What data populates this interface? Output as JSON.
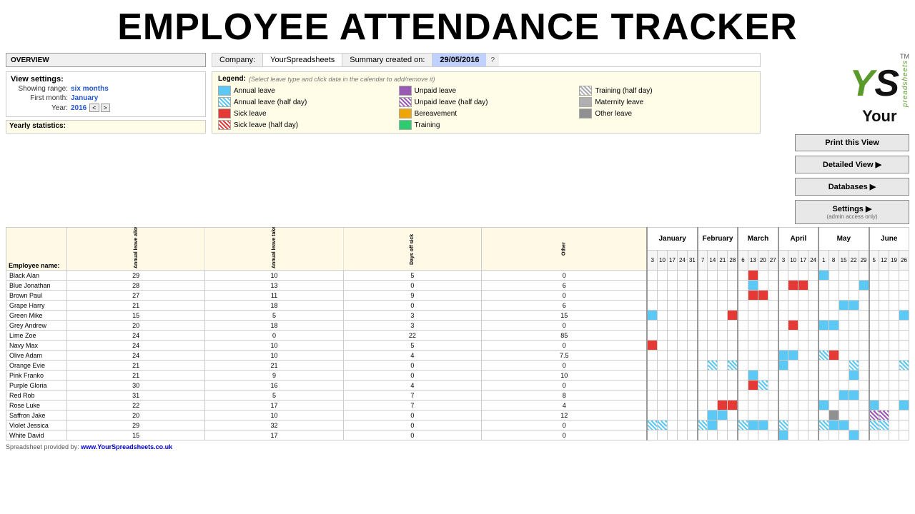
{
  "title": "EMPLOYEE ATTENDANCE TRACKER",
  "header": {
    "company_label": "Company:",
    "company_value": "YourSpreadsheets",
    "summary_label": "Summary created on:",
    "summary_date": "29/05/2016",
    "overview_label": "OVERVIEW"
  },
  "view_settings": {
    "label": "View settings:",
    "showing_range_label": "Showing range:",
    "showing_range_value": "six months",
    "first_month_label": "First month:",
    "first_month_value": "January",
    "year_label": "Year:",
    "year_value": "2016"
  },
  "legend": {
    "title": "Legend:",
    "hint": "(Select leave type and click data in the calendar to add/remove it)",
    "items": [
      {
        "label": "Annual leave",
        "color": "#5bc8f5",
        "type": "solid"
      },
      {
        "label": "Annual leave (half day)",
        "color": "#5bc8f5",
        "type": "stripe"
      },
      {
        "label": "Sick leave",
        "color": "#e53935",
        "type": "solid"
      },
      {
        "label": "Sick leave (half day)",
        "color": "#e53935",
        "type": "stripe"
      },
      {
        "label": "Unpaid leave",
        "color": "#9b59b6",
        "type": "solid"
      },
      {
        "label": "Unpaid leave (half day)",
        "color": "#9b59b6",
        "type": "stripe"
      },
      {
        "label": "Bereavement",
        "color": "#f0a500",
        "type": "solid"
      },
      {
        "label": "Training",
        "color": "#2ecc71",
        "type": "solid"
      },
      {
        "label": "Training (half day)",
        "color": "#aaa",
        "type": "stripe"
      },
      {
        "label": "Maternity leave",
        "color": "#b0b0b0",
        "type": "solid"
      },
      {
        "label": "Other leave",
        "color": "#909090",
        "type": "solid"
      }
    ]
  },
  "buttons": {
    "print": "Print this View",
    "detailed": "Detailed View ▶",
    "databases": "Databases ▶",
    "settings": "Settings ▶",
    "settings_note": "(admin access only)"
  },
  "yearly_stats_label": "Yearly statistics:",
  "columns": {
    "annual_allowance": "Annual leave allowance",
    "annual_taken": "Annual leave taken",
    "days_off_sick": "Days off sick",
    "other": "Other"
  },
  "employees": [
    {
      "name": "Black Alan",
      "allowance": 29,
      "taken": 10,
      "sick": 5,
      "other": 0
    },
    {
      "name": "Blue Jonathan",
      "allowance": 28,
      "taken": 13,
      "sick": 0,
      "other": 6
    },
    {
      "name": "Brown Paul",
      "allowance": 27,
      "taken": 11,
      "sick": 9,
      "other": 0
    },
    {
      "name": "Grape Harry",
      "allowance": 21,
      "taken": 18,
      "sick": 0,
      "other": 6
    },
    {
      "name": "Green Mike",
      "allowance": 15,
      "taken": 5,
      "sick": 3,
      "other": 15
    },
    {
      "name": "Grey Andrew",
      "allowance": 20,
      "taken": 18,
      "sick": 3,
      "other": 0
    },
    {
      "name": "Lime Zoe",
      "allowance": 24,
      "taken": 0,
      "sick": 22,
      "other": 85
    },
    {
      "name": "Navy Max",
      "allowance": 24,
      "taken": 10,
      "sick": 5,
      "other": 0
    },
    {
      "name": "Olive Adam",
      "allowance": 24,
      "taken": 10,
      "sick": 4,
      "other": 7.5
    },
    {
      "name": "Orange Evie",
      "allowance": 21,
      "taken": 21,
      "sick": 0,
      "other": 0
    },
    {
      "name": "Pink Franko",
      "allowance": 21,
      "taken": 9,
      "sick": 0,
      "other": 10
    },
    {
      "name": "Purple Gloria",
      "allowance": 30,
      "taken": 16,
      "sick": 4,
      "other": 0
    },
    {
      "name": "Red Rob",
      "allowance": 31,
      "taken": 5,
      "sick": 7,
      "other": 8
    },
    {
      "name": "Rose Luke",
      "allowance": 22,
      "taken": 17,
      "sick": 7,
      "other": 4
    },
    {
      "name": "Saffron Jake",
      "allowance": 20,
      "taken": 10,
      "sick": 0,
      "other": 12
    },
    {
      "name": "Violet Jessica",
      "allowance": 29,
      "taken": 32,
      "sick": 0,
      "other": 0
    },
    {
      "name": "White David",
      "allowance": 15,
      "taken": 17,
      "sick": 0,
      "other": 0
    }
  ],
  "months": [
    {
      "label": "January",
      "days": [
        "3",
        "10",
        "17",
        "24",
        "31"
      ]
    },
    {
      "label": "February",
      "days": [
        "7",
        "14",
        "21",
        "28"
      ]
    },
    {
      "label": "March",
      "days": [
        "6",
        "13",
        "20",
        "27"
      ]
    },
    {
      "label": "April",
      "days": [
        "3",
        "10",
        "17",
        "24"
      ]
    },
    {
      "label": "May",
      "days": [
        "1",
        "8",
        "15",
        "22",
        "29"
      ]
    },
    {
      "label": "June",
      "days": [
        "5",
        "12",
        "19",
        "26"
      ]
    }
  ],
  "footer": {
    "text": "Spreadsheet provided by:",
    "link": "www.YourSpreadsheets.co.uk"
  }
}
